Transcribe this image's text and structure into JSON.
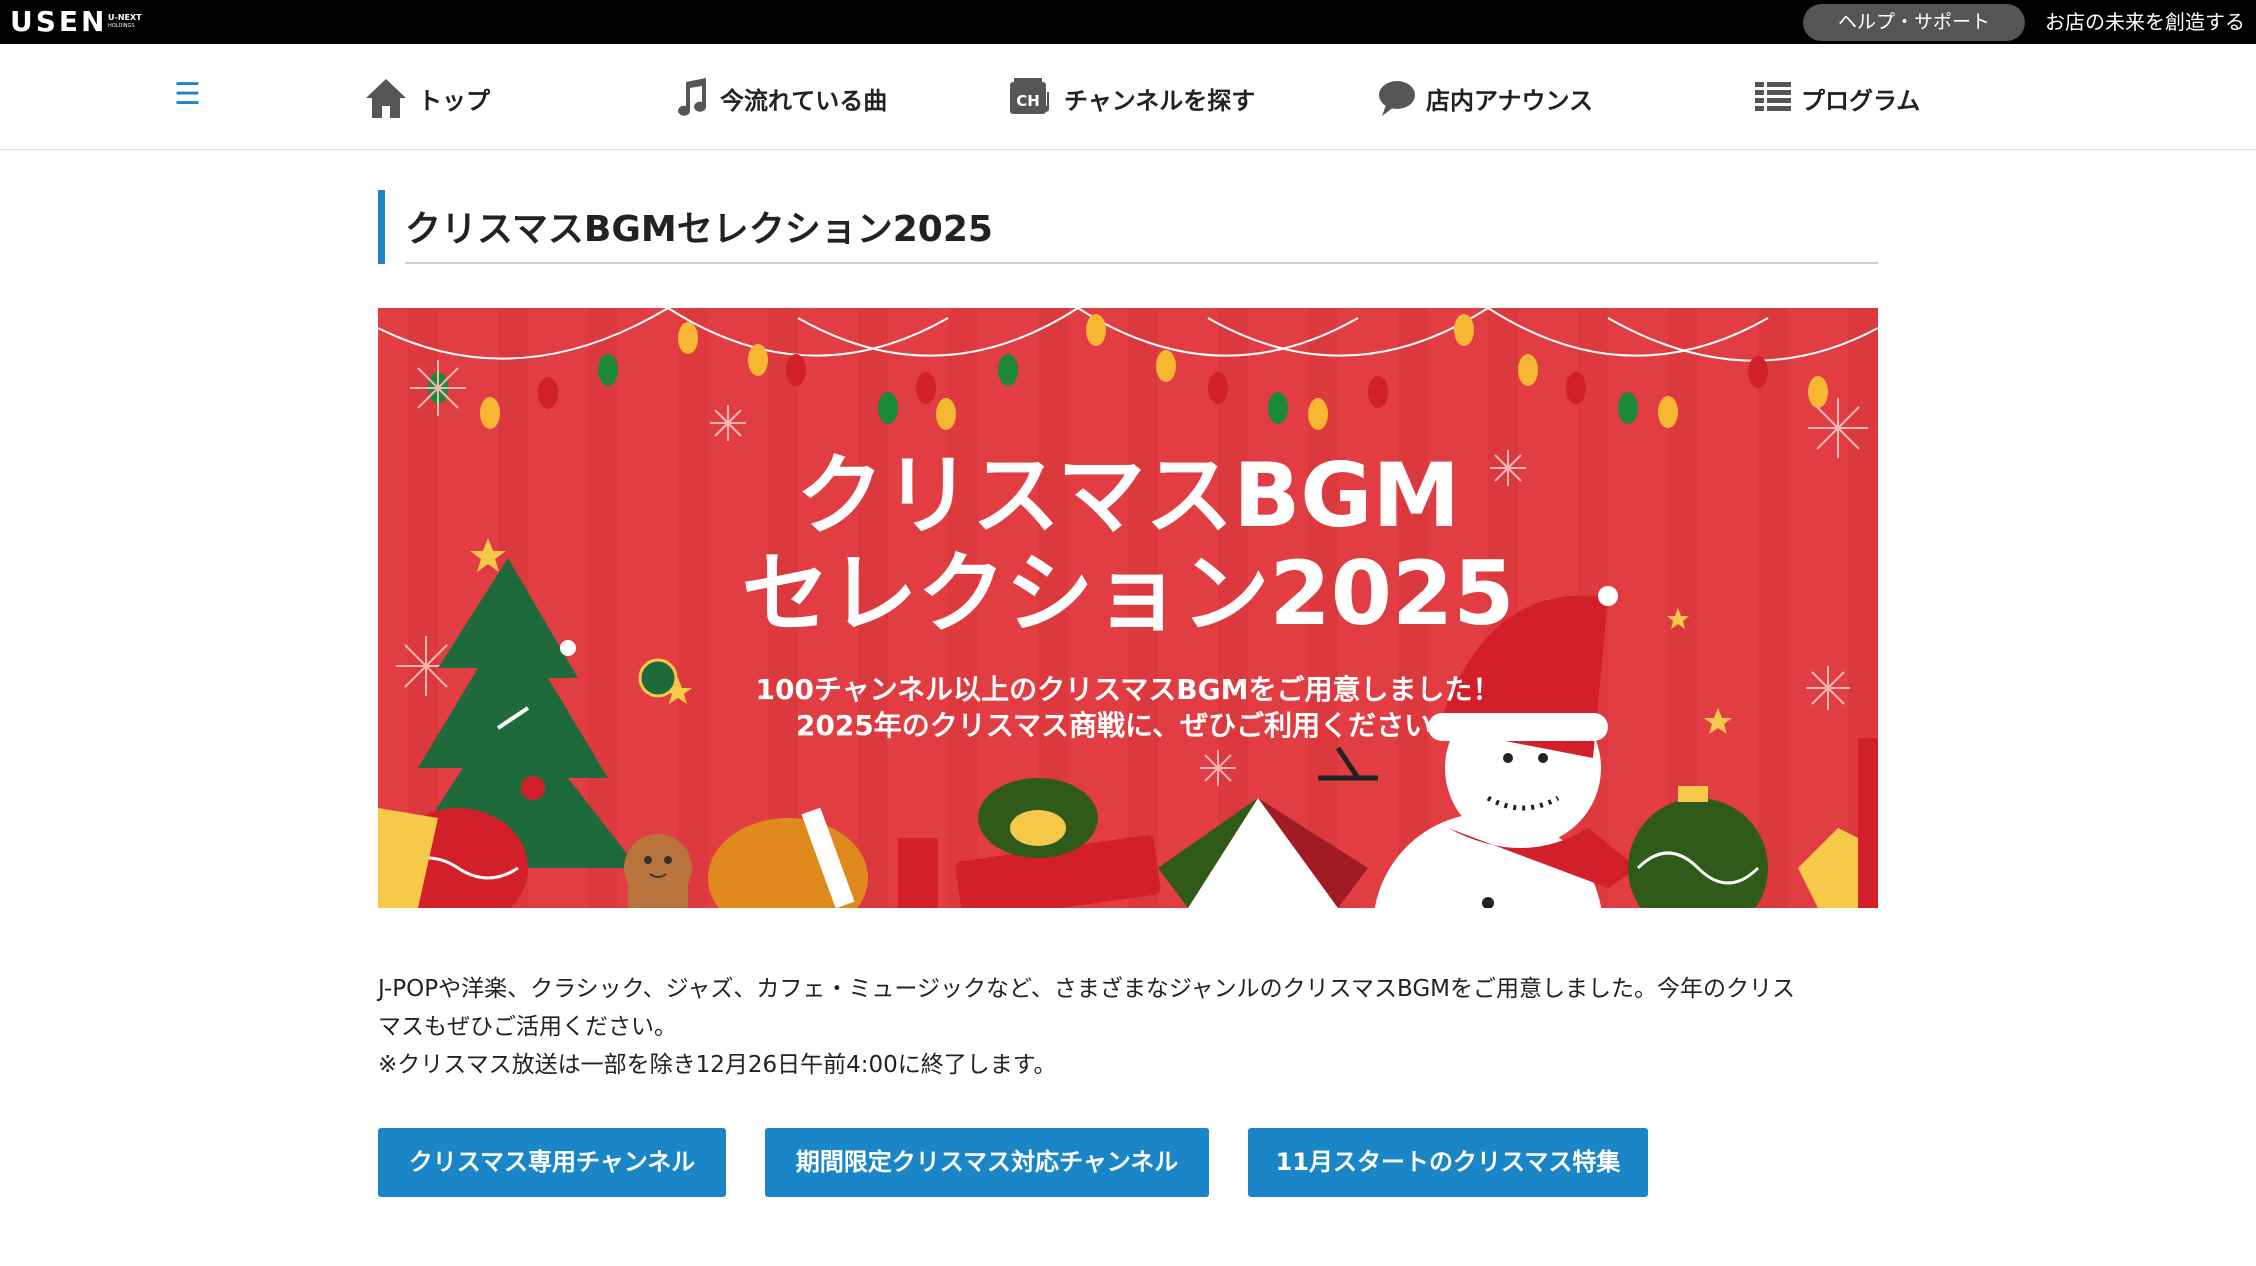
{
  "topbar": {
    "logo": "USEN",
    "logo_sub": "U-NEXT",
    "logo_sub2": "HOLDINGS",
    "help_label": "ヘルプ・サポート",
    "tagline": "お店の未来を創造する"
  },
  "nav": {
    "menu_icon": "hamburger-icon",
    "items": [
      {
        "label": "トップ",
        "icon": "home-icon"
      },
      {
        "label": "今流れている曲",
        "icon": "music-note-icon"
      },
      {
        "label": "チャンネルを探す",
        "icon": "channel-icon"
      },
      {
        "label": "店内アナウンス",
        "icon": "speech-bubble-icon"
      },
      {
        "label": "プログラム",
        "icon": "grid-icon"
      }
    ]
  },
  "page": {
    "title": "クリスマスBGMセレクション2025"
  },
  "banner": {
    "title_line1": "クリスマスBGM",
    "title_line2": "セレクション2025",
    "sub_line1": "100チャンネル以上のクリスマスBGMをご用意しました！",
    "sub_line2": "2025年のクリスマス商戦に、ぜひご利用ください。"
  },
  "description": {
    "line1": "J-POPや洋楽、クラシック、ジャズ、カフェ・ミュージックなど、さまざまなジャンルのクリスマスBGMをご用意しました。今年のクリス",
    "line2": "マスもぜひご活用ください。",
    "line3": "※クリスマス放送は一部を除き12月26日午前4:00に終了します。"
  },
  "buttons": {
    "christmas_channels": "クリスマス専用チャンネル",
    "limited_channels": "期間限定クリスマス対応チャンネル",
    "november_feature": "11月スタートのクリスマス特集"
  },
  "colors": {
    "accent": "#1b86c7",
    "banner_bg": "#e23d43",
    "topbar_bg": "#000000"
  }
}
